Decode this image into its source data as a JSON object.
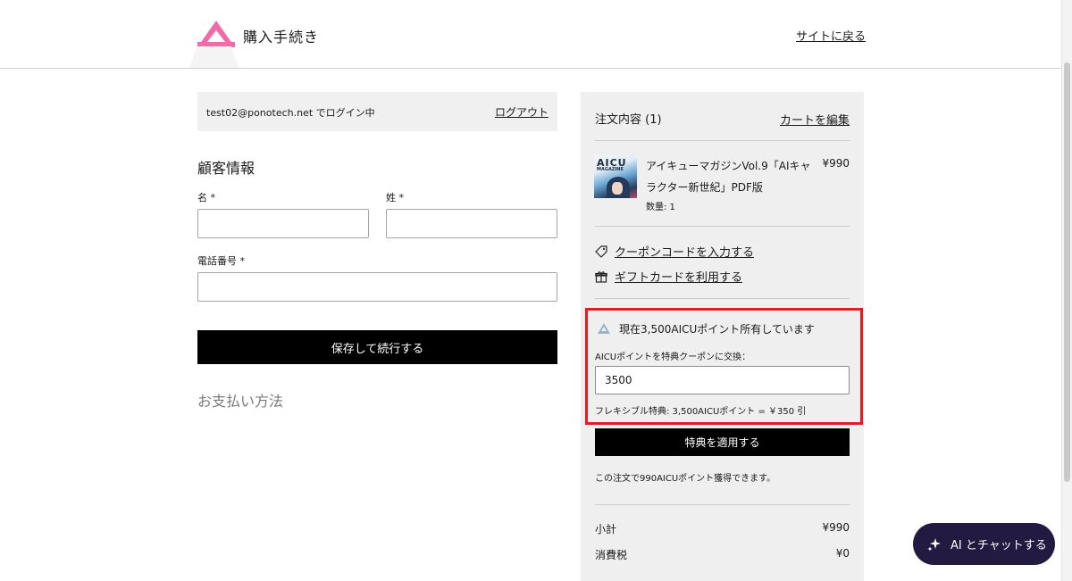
{
  "header": {
    "title": "購入手続き",
    "back_link": "サイトに戻る",
    "logo_color": "#f06ca8"
  },
  "account": {
    "logged_in_text": "test02@ponotech.net でログイン中",
    "logout_label": "ログアウト"
  },
  "customer": {
    "section_title": "顧客情報",
    "first_name_label": "名 *",
    "last_name_label": "姓 *",
    "phone_label": "電話番号 *",
    "first_name_value": "",
    "last_name_value": "",
    "phone_value": "",
    "continue_button": "保存して続行する"
  },
  "payment": {
    "section_title": "お支払い方法"
  },
  "order": {
    "title": "注文内容 (1)",
    "edit_cart": "カートを編集",
    "items": [
      {
        "name": "アイキューマガジンVol.9「AIキャラクター新世紀」PDF版",
        "price": "¥990",
        "quantity": "数量: 1",
        "thumb_title": "AICU",
        "thumb_subtitle": "MAGAZINE"
      }
    ],
    "coupon_link": "クーポンコードを入力する",
    "gift_card_link": "ギフトカードを利用する"
  },
  "points": {
    "owned_text": "現在3,500AICUポイント所有しています",
    "exchange_label": "AICUポイントを特典クーポンに交換：",
    "input_value": "3500",
    "flex_note": "フレキシブル特典: 3,500AICUポイント = ￥350 引",
    "apply_button": "特典を適用する",
    "earn_text": "この注文で990AICUポイント獲得できます。",
    "highlight_color": "#e01e1e"
  },
  "totals": {
    "subtotal_label": "小計",
    "subtotal_value": "¥990",
    "tax_label": "消費税",
    "tax_value": "¥0"
  },
  "chat": {
    "label": "AI とチャットする",
    "background": "#231a42"
  }
}
